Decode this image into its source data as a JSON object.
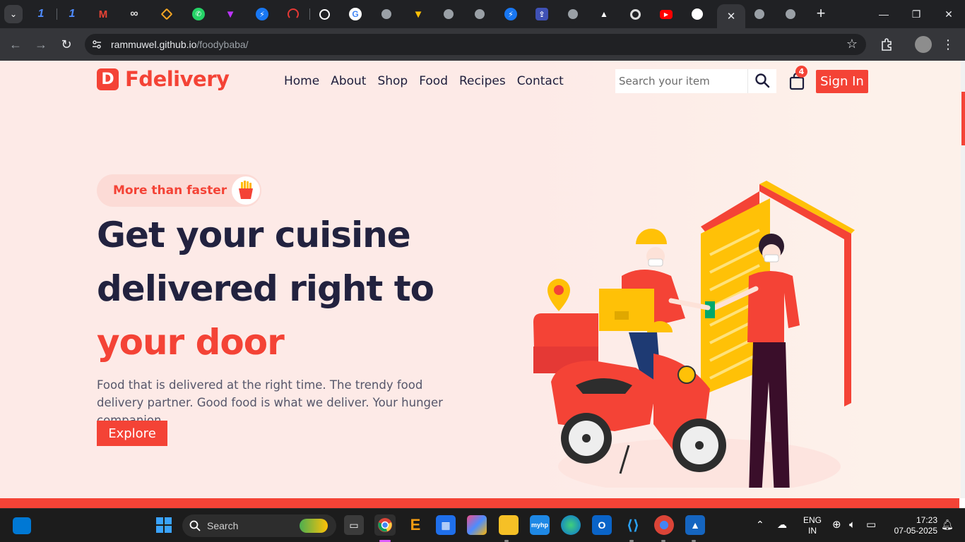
{
  "browser": {
    "active_tab_close": "✕",
    "new_tab": "+",
    "url_host": "rammuwel.github.io",
    "url_path": "/foodybaba/",
    "window": {
      "minimize": "—",
      "restore": "❐",
      "close": "✕"
    },
    "tab_icons": [
      "tab-menu",
      "app-1-icon",
      "app-2-icon",
      "gmail-icon",
      "infinity-icon",
      "stack-icon",
      "whatsapp-icon",
      "vite-icon",
      "messenger-icon",
      "speedometer-icon",
      "openai-icon",
      "google-icon",
      "globe-icon",
      "vite-icon",
      "globe-icon",
      "globe-icon",
      "messenger-icon",
      "upload-icon",
      "globe-icon",
      "triangle-icon",
      "chrome-icon",
      "youtube-icon",
      "github-icon",
      "github-active-icon",
      "globe-icon",
      "globe-icon"
    ]
  },
  "site": {
    "logo_letter": "D",
    "logo_text": "Fdelivery",
    "nav": [
      "Home",
      "About",
      "Shop",
      "Food",
      "Recipes",
      "Contact"
    ],
    "search": {
      "placeholder": "Search your item"
    },
    "cart_count": "4",
    "signin_label": "Sign In",
    "pill_text": "More than faster",
    "headline": {
      "line1": "Get your cuisine",
      "line2": "delivered right to",
      "line3": "your door"
    },
    "description": "Food that is delivered at the right time. The trendy food delivery partner. Good food is what we deliver. Your hunger companion.",
    "explore_label": "Explore",
    "colors": {
      "accent": "#f44336",
      "heading": "#22223f",
      "background": "#fdeae7"
    }
  },
  "taskbar": {
    "search_label": "Search",
    "lang_line1": "ENG",
    "lang_line2": "IN",
    "time": "17:23",
    "date": "07-05-2025"
  }
}
